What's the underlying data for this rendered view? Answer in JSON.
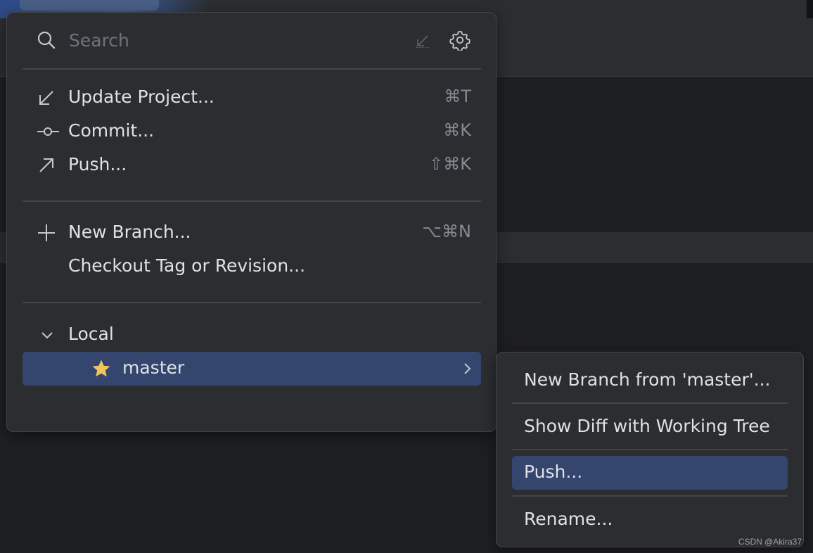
{
  "search": {
    "placeholder": "Search",
    "value": ""
  },
  "actions": [
    {
      "label": "Update Project...",
      "shortcut": "⌘T",
      "icon": "update-arrow-icon"
    },
    {
      "label": "Commit...",
      "shortcut": "⌘K",
      "icon": "commit-icon"
    },
    {
      "label": "Push...",
      "shortcut": "⇧⌘K",
      "icon": "push-arrow-icon"
    }
  ],
  "branch_actions": [
    {
      "label": "New Branch...",
      "shortcut": "⌥⌘N",
      "icon": "plus-icon"
    },
    {
      "label": "Checkout Tag or Revision...",
      "shortcut": ""
    }
  ],
  "local": {
    "group_label": "Local",
    "branches": [
      {
        "name": "master",
        "favorite": true,
        "selected": true
      }
    ]
  },
  "submenu": {
    "items": [
      {
        "label": "New Branch from 'master'..."
      },
      {
        "label": "Show Diff with Working Tree"
      },
      {
        "label": "Push...",
        "selected": true
      },
      {
        "label": "Rename..."
      }
    ]
  },
  "watermark": "CSDN @Akira37",
  "colors": {
    "background": "#1e1f22",
    "popup": "#2b2d30",
    "selection": "#34466e",
    "text": "#dfe1e5",
    "muted": "#868a91",
    "star": "#f2c55c"
  }
}
